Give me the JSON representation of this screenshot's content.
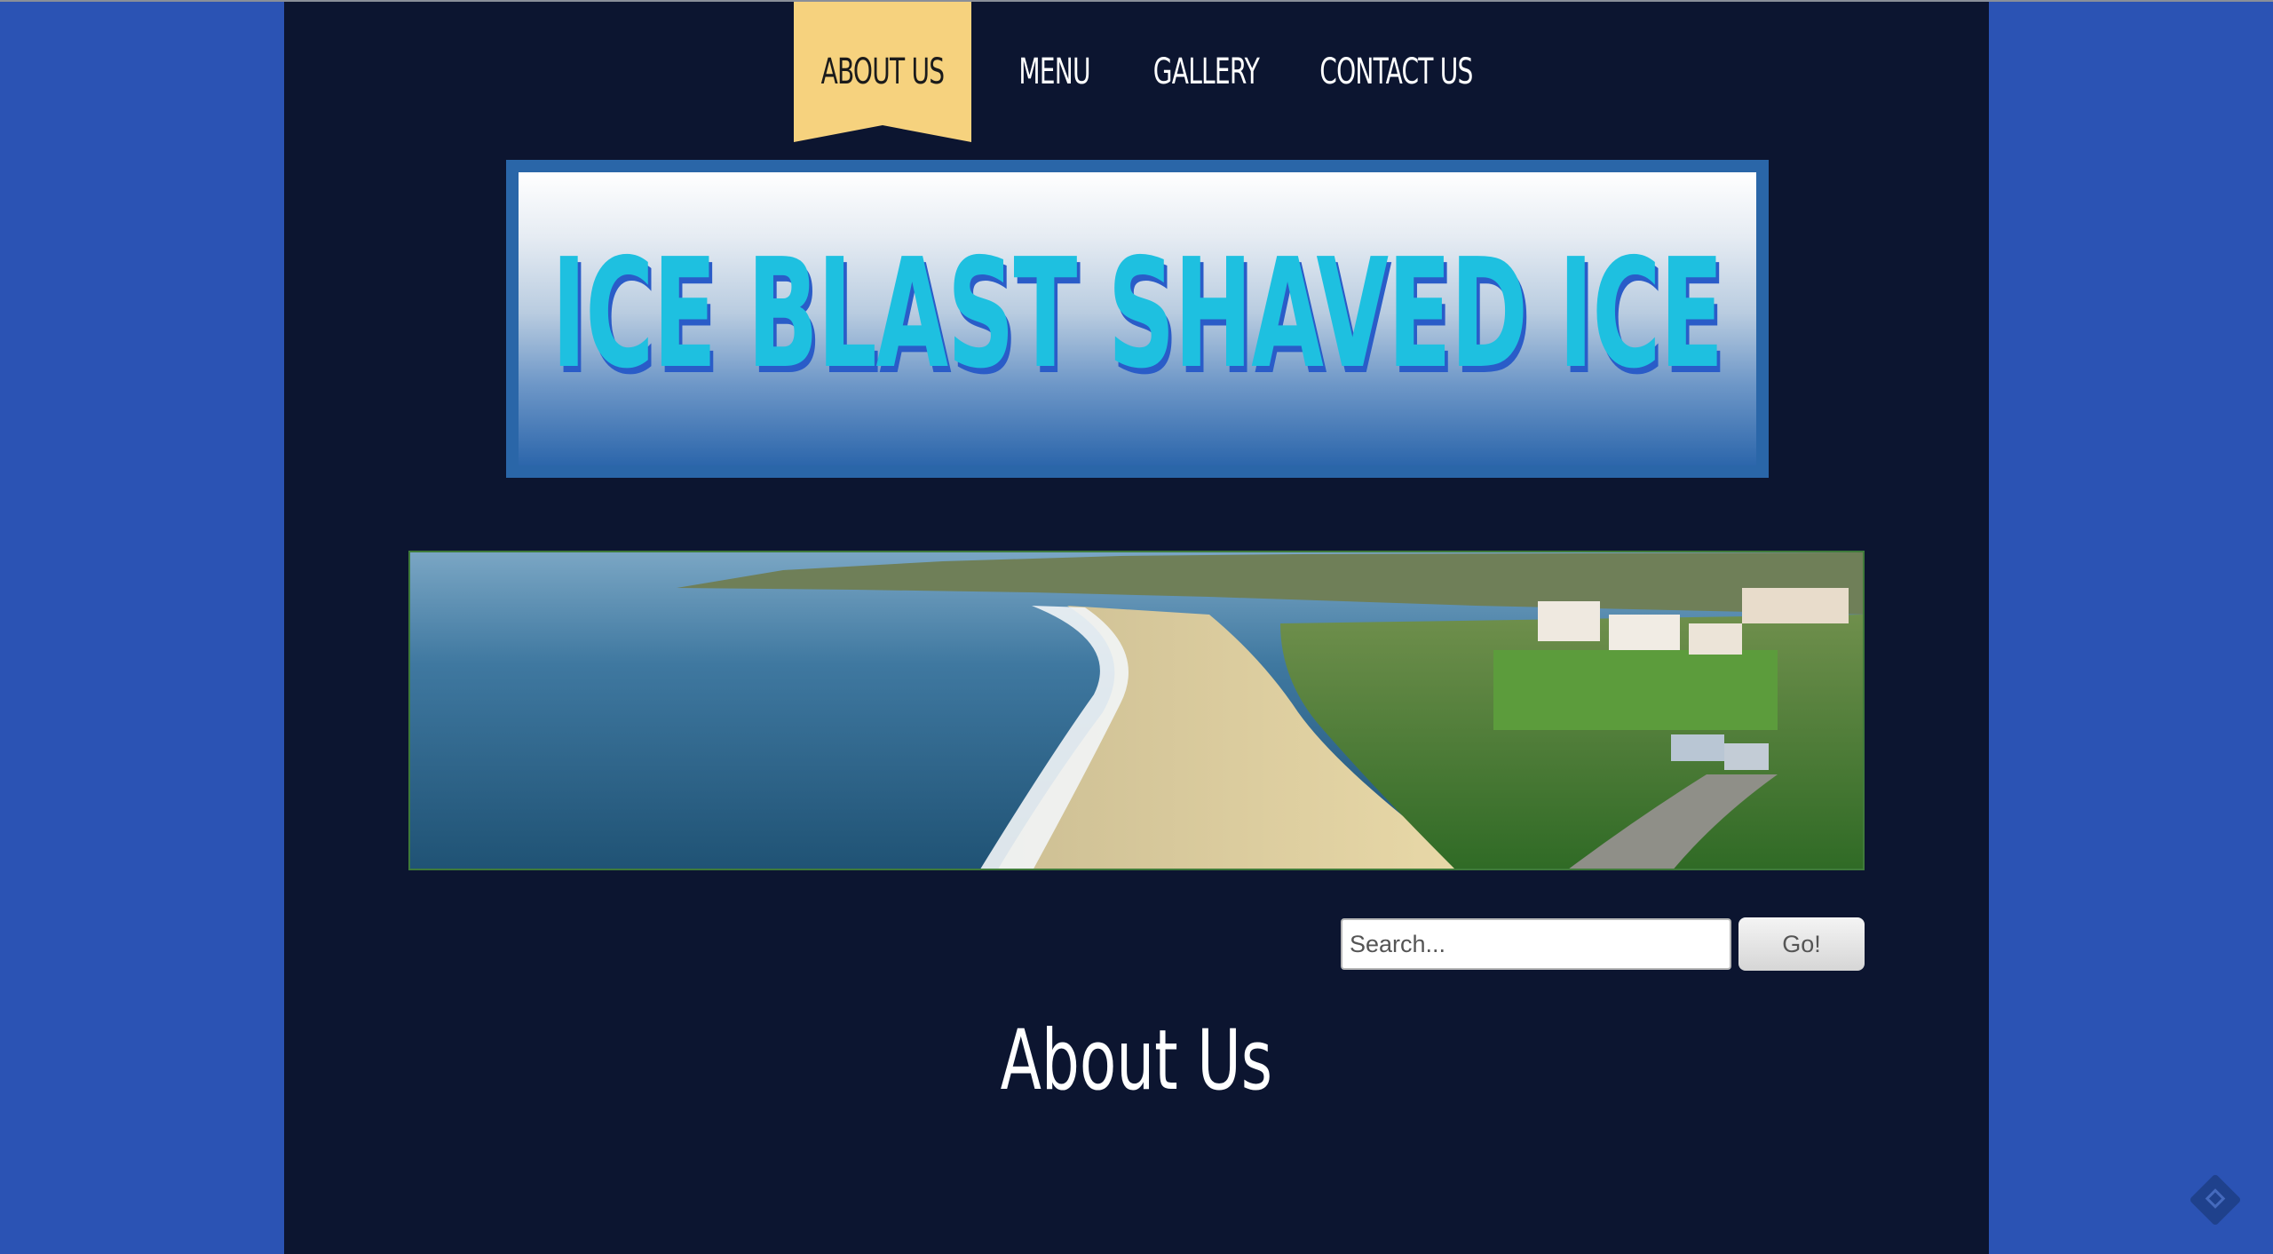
{
  "nav": {
    "items": [
      {
        "label": "ABOUT US",
        "active": true
      },
      {
        "label": "MENU",
        "active": false
      },
      {
        "label": "GALLERY",
        "active": false
      },
      {
        "label": "CONTACT US",
        "active": false
      }
    ]
  },
  "banner": {
    "title": "ICE BLAST SHAVED ICE"
  },
  "search": {
    "placeholder": "Search...",
    "value": "",
    "button_label": "Go!"
  },
  "main": {
    "heading": "About Us"
  },
  "colors": {
    "page_bg": "#2b53b4",
    "content_bg": "#0c1530",
    "active_tab": "#f6d27e",
    "banner_text": "#1ec0e0"
  },
  "icons": {
    "corner": "feedback-diamond-icon"
  }
}
